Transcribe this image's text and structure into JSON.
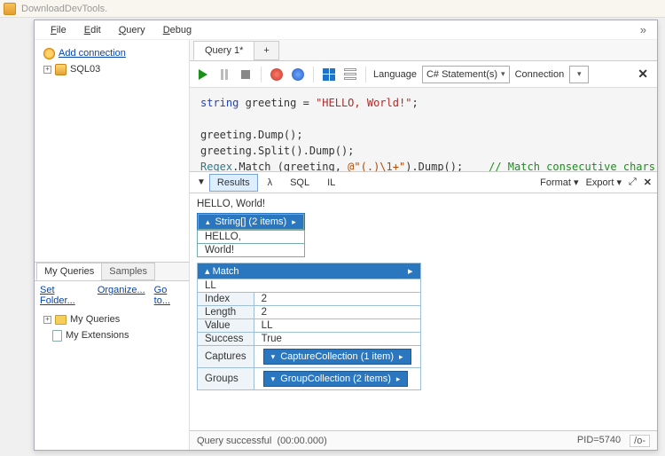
{
  "app_title": "DownloadDevTools.",
  "menu": {
    "file": "File",
    "edit": "Edit",
    "query": "Query",
    "debug": "Debug"
  },
  "sidebar": {
    "connections": {
      "add_label": "Add connection",
      "items": [
        "SQL03"
      ]
    },
    "tabs": {
      "my_queries": "My Queries",
      "samples": "Samples"
    },
    "links": {
      "set_folder": "Set Folder...",
      "organize": "Organize...",
      "goto": "Go to..."
    },
    "tree": {
      "my_queries": "My Queries",
      "my_extensions": "My Extensions"
    }
  },
  "tabs": {
    "query1": "Query 1*",
    "add": "+"
  },
  "toolbar": {
    "language_label": "Language",
    "language_value": "C# Statement(s)",
    "connection_label": "Connection"
  },
  "code": {
    "l1a": "string",
    "l1b": " greeting = ",
    "l1c": "\"HELLO, World!\"",
    "l1d": ";",
    "l2": "greeting.Dump();",
    "l3": "greeting.Split().Dump();",
    "l4a": "Regex",
    "l4b": ".Match (greeting, ",
    "l4c": "@\"(.)\\1+\"",
    "l4d": ").Dump();    ",
    "l4e": "// Match consecutive chars"
  },
  "result_tabs": {
    "results": "Results",
    "lambda": "λ",
    "sql": "SQL",
    "il": "IL"
  },
  "result_right": {
    "format": "Format",
    "export": "Export"
  },
  "results": {
    "greeting": "HELLO, World!",
    "string_header": "String[] (2 items)",
    "string_items": [
      "HELLO,",
      "World!"
    ],
    "match": {
      "header": "Match",
      "text": "LL",
      "rows": {
        "index_k": "Index",
        "index_v": "2",
        "length_k": "Length",
        "length_v": "2",
        "value_k": "Value",
        "value_v": "LL",
        "success_k": "Success",
        "success_v": "True",
        "captures_k": "Captures",
        "captures_chip": "CaptureCollection (1 item)",
        "groups_k": "Groups",
        "groups_chip": "GroupCollection (2 items)"
      }
    }
  },
  "status": {
    "msg": "Query successful",
    "time": "(00:00.000)",
    "pid": "PID=5740",
    "extra": "/o-"
  }
}
